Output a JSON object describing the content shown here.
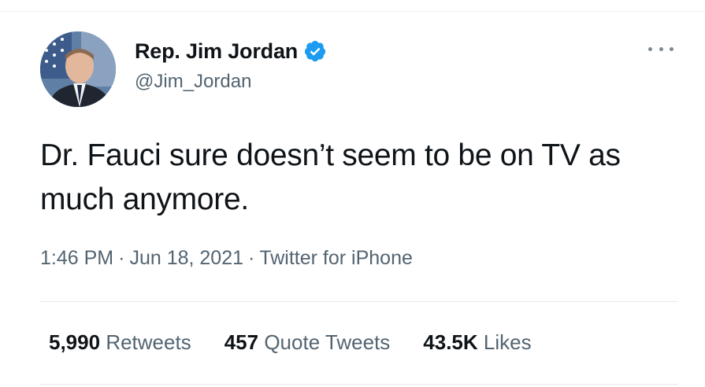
{
  "tweet": {
    "author": {
      "display_name": "Rep. Jim Jordan",
      "handle": "@Jim_Jordan",
      "verified": true
    },
    "text": "Dr. Fauci sure doesn’t seem to be on TV as much anymore.",
    "time": "1:46 PM",
    "separator": "·",
    "date": "Jun 18, 2021",
    "source": "Twitter for iPhone",
    "stats": {
      "retweets_count": "5,990",
      "retweets_label": "Retweets",
      "quote_count": "457",
      "quote_label": "Quote Tweets",
      "likes_count": "43.5K",
      "likes_label": "Likes"
    }
  },
  "colors": {
    "text_primary": "#0f1419",
    "text_secondary": "#536471",
    "verified_badge": "#1d9bf0",
    "divider": "#e6e9eb"
  },
  "icons": {
    "verified": "verified-badge-icon",
    "more": "more-options-icon"
  }
}
